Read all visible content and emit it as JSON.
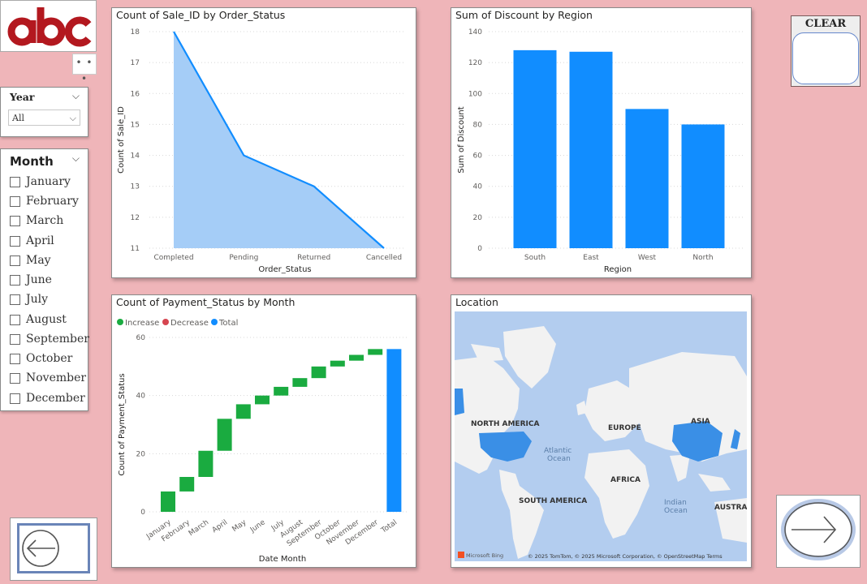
{
  "slicers": {
    "year": {
      "header": "Year",
      "selected": "All"
    },
    "month": {
      "header": "Month",
      "options": [
        "January",
        "February",
        "March",
        "April",
        "May",
        "June",
        "July",
        "August",
        "September",
        "October",
        "November",
        "December"
      ]
    }
  },
  "buttons": {
    "more": "• • •",
    "clear": "CLEAR",
    "back_icon": "arrow-left-icon",
    "next_icon": "arrow-right-icon"
  },
  "map": {
    "title": "Location",
    "labels": [
      "NORTH AMERICA",
      "EUROPE",
      "ASIA",
      "Atlantic Ocean",
      "AFRICA",
      "SOUTH AMERICA",
      "Indian Ocean",
      "AUSTRALIA"
    ],
    "label_atlantic_1": "Atlantic",
    "label_atlantic_2": "Ocean",
    "label_indian_1": "Indian",
    "label_indian_2": "Ocean",
    "attribution": "© 2025 TomTom, © 2025 Microsoft Corporation, © OpenStreetMap  Terms",
    "brand": "Microsoft Bing",
    "ocean_color": "#b3cdef",
    "land_color": "#f2f2f2",
    "highlight_color": "#3a8fe6"
  },
  "colors": {
    "page_bg": "#efb5b9",
    "primary": "#118dff",
    "area_fill": "#a5cdf7",
    "increase": "#1aab40",
    "decrease": "#d64550",
    "total": "#118dff"
  },
  "chart_data": [
    {
      "type": "area",
      "title": "Count of Sale_ID by Order_Status",
      "xlabel": "Order_Status",
      "ylabel": "Count of Sale_ID",
      "categories": [
        "Completed",
        "Pending",
        "Returned",
        "Cancelled"
      ],
      "values": [
        18,
        14,
        13,
        11
      ],
      "ylim": [
        11,
        18
      ],
      "yticks": [
        11,
        12,
        13,
        14,
        15,
        16,
        17,
        18
      ],
      "grid": true
    },
    {
      "type": "bar",
      "title": "Sum of Discount by Region",
      "xlabel": "Region",
      "ylabel": "Sum of Discount",
      "categories": [
        "South",
        "East",
        "West",
        "North"
      ],
      "values": [
        128,
        127,
        90,
        80
      ],
      "ylim": [
        0,
        140
      ],
      "yticks": [
        0,
        20,
        40,
        60,
        80,
        100,
        120,
        140
      ],
      "grid": true
    },
    {
      "type": "bar",
      "subtype": "waterfall",
      "title": "Count of Payment_Status by Month",
      "xlabel": "Date Month",
      "ylabel": "Count of Payment_Status",
      "legend": [
        "Increase",
        "Decrease",
        "Total"
      ],
      "legend_position": "top-left",
      "categories": [
        "January",
        "February",
        "March",
        "April",
        "May",
        "June",
        "July",
        "August",
        "September",
        "October",
        "November",
        "December",
        "Total"
      ],
      "values": [
        7,
        5,
        9,
        11,
        5,
        3,
        3,
        3,
        4,
        2,
        2,
        2,
        56
      ],
      "ylim": [
        0,
        60
      ],
      "yticks": [
        0,
        20,
        40,
        60
      ],
      "grid": true
    }
  ]
}
